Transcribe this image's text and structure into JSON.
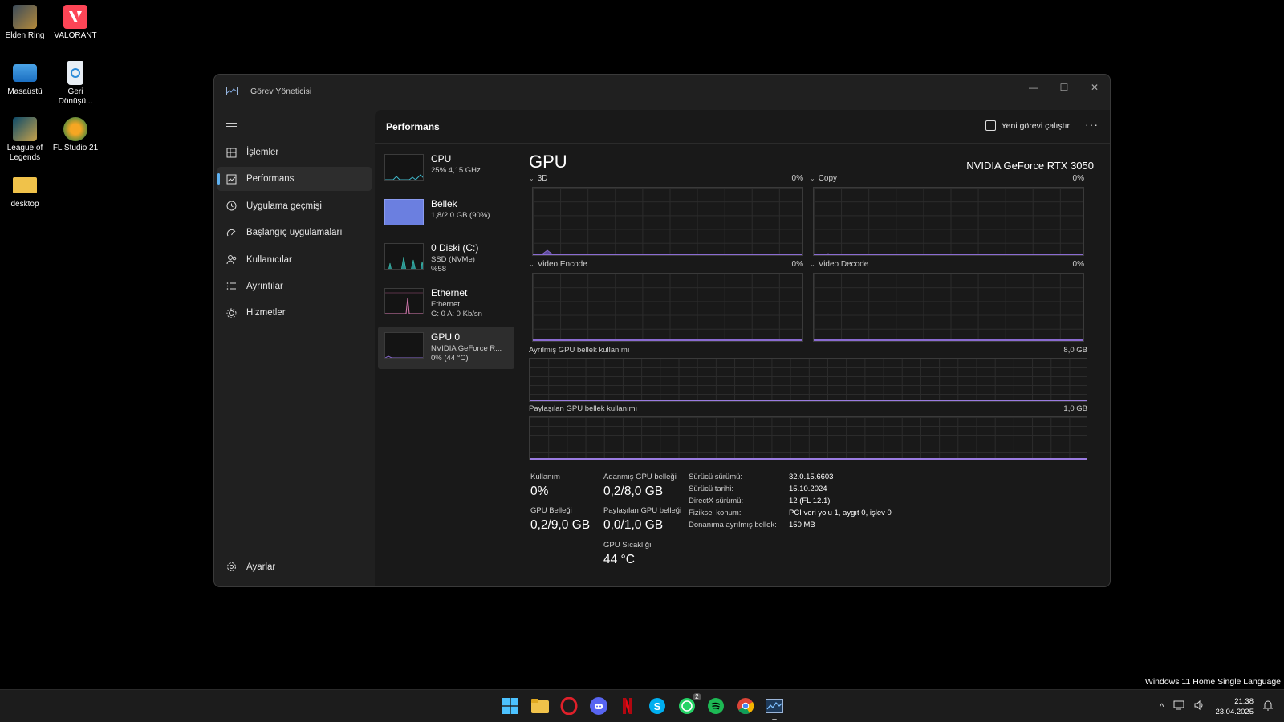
{
  "desktop": {
    "icons": [
      {
        "label": "Elden Ring",
        "icon": "elden-ring-icon"
      },
      {
        "label": "VALORANT",
        "icon": "valorant-icon"
      },
      {
        "label": "Masaüstü",
        "icon": "monitor-icon"
      },
      {
        "label": "Geri Dönüşü...",
        "icon": "recycle-bin-icon"
      },
      {
        "label": "League of Legends",
        "icon": "league-of-legends-icon"
      },
      {
        "label": "FL Studio 21",
        "icon": "fl-studio-icon"
      },
      {
        "label": "desktop",
        "icon": "folder-icon"
      }
    ],
    "watermark": "Windows 11 Home Single Language"
  },
  "window": {
    "title": "Görev Yöneticisi",
    "controls": {
      "minimize": "—",
      "maximize": "☐",
      "close": "✕"
    }
  },
  "sidebar": {
    "items": [
      {
        "label": "İşlemler",
        "icon": "processes-icon"
      },
      {
        "label": "Performans",
        "icon": "performance-icon",
        "active": true
      },
      {
        "label": "Uygulama geçmişi",
        "icon": "history-icon"
      },
      {
        "label": "Başlangıç uygulamaları",
        "icon": "startup-icon"
      },
      {
        "label": "Kullanıcılar",
        "icon": "users-icon"
      },
      {
        "label": "Ayrıntılar",
        "icon": "details-icon"
      },
      {
        "label": "Hizmetler",
        "icon": "services-icon"
      }
    ],
    "settings_label": "Ayarlar"
  },
  "header": {
    "title": "Performans",
    "run_new_task": "Yeni görevi çalıştır",
    "more": "···"
  },
  "devices": [
    {
      "name": "CPU",
      "line1": "25% 4,15 GHz",
      "line2": ""
    },
    {
      "name": "Bellek",
      "line1": "1,8/2,0 GB (90%)",
      "line2": ""
    },
    {
      "name": "0 Diski (C:)",
      "line1": "SSD (NVMe)",
      "line2": "%58"
    },
    {
      "name": "Ethernet",
      "line1": "Ethernet",
      "line2": "G: 0 A: 0 Kb/sn"
    },
    {
      "name": "GPU 0",
      "line1": "NVIDIA GeForce R...",
      "line2": "0% (44 °C)",
      "selected": true
    }
  ],
  "gpu": {
    "title": "GPU",
    "model": "NVIDIA GeForce RTX 3050",
    "engines": [
      {
        "name": "3D",
        "value": "0%"
      },
      {
        "name": "Copy",
        "value": "0%"
      },
      {
        "name": "Video Encode",
        "value": "0%"
      },
      {
        "name": "Video Decode",
        "value": "0%"
      }
    ],
    "dedicated_mem": {
      "label": "Ayrılmış GPU bellek kullanımı",
      "max": "8,0 GB"
    },
    "shared_mem": {
      "label": "Paylaşılan GPU bellek kullanımı",
      "max": "1,0 GB"
    },
    "stats": {
      "usage_label": "Kullanım",
      "usage_value": "0%",
      "dedicated_label": "Adanmış GPU belleği",
      "dedicated_value": "0,2/8,0 GB",
      "gpu_mem_label": "GPU Belleği",
      "gpu_mem_value": "0,2/9,0 GB",
      "shared_label": "Paylaşılan GPU belleği",
      "shared_value": "0,0/1,0 GB",
      "temp_label": "GPU Sıcaklığı",
      "temp_value": "44 °C"
    },
    "properties": [
      {
        "key": "Sürücü sürümü:",
        "value": "32.0.15.6603"
      },
      {
        "key": "Sürücü tarihi:",
        "value": "15.10.2024"
      },
      {
        "key": "DirectX sürümü:",
        "value": "12 (FL 12.1)"
      },
      {
        "key": "Fiziksel konum:",
        "value": "PCI veri yolu 1, aygıt 0, işlev 0"
      },
      {
        "key": "Donanıma ayrılmış bellek:",
        "value": "150 MB"
      }
    ]
  },
  "taskbar": {
    "apps": [
      "start-icon",
      "file-explorer-icon",
      "opera-icon",
      "discord-icon",
      "netflix-icon",
      "skype-icon",
      "whatsapp-icon",
      "spotify-icon",
      "chrome-icon",
      "task-manager-icon"
    ],
    "whatsapp_badge": "2",
    "time": "21:38",
    "date": "23.04.2025"
  },
  "colors": {
    "accent": "#5fb2f2",
    "gpu_line": "#8a6bd1",
    "memory_fill": "#6b7fe0",
    "ethernet_line": "#e07fb8",
    "cpu_line": "#3fb6c9"
  }
}
